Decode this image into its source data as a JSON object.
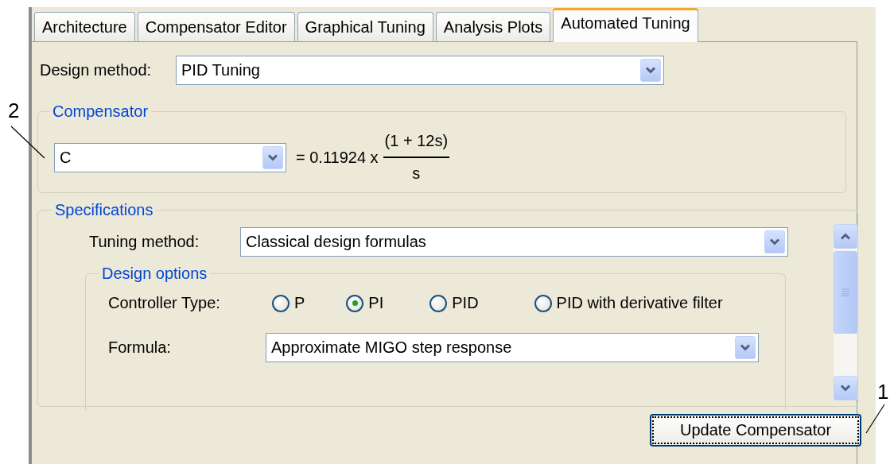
{
  "tabs": [
    {
      "label": "Architecture",
      "selected": false
    },
    {
      "label": "Compensator Editor",
      "selected": false
    },
    {
      "label": "Graphical Tuning",
      "selected": false
    },
    {
      "label": "Analysis Plots",
      "selected": false
    },
    {
      "label": "Automated Tuning",
      "selected": true
    }
  ],
  "design_method": {
    "label": "Design method:",
    "value": "PID Tuning"
  },
  "compensator": {
    "title": "Compensator",
    "selector": "C",
    "equation": {
      "prefix": "= 0.11924 x",
      "numerator": "(1 + 12s)",
      "denominator": "s"
    }
  },
  "specifications": {
    "title": "Specifications",
    "tuning_method": {
      "label": "Tuning method:",
      "value": "Classical design formulas"
    },
    "design_options": {
      "title": "Design options",
      "controller_type": {
        "label": "Controller Type:",
        "options": [
          {
            "label": "P",
            "selected": false
          },
          {
            "label": "PI",
            "selected": true
          },
          {
            "label": "PID",
            "selected": false
          },
          {
            "label": "PID with derivative filter",
            "selected": false
          }
        ]
      },
      "formula": {
        "label": "Formula:",
        "value": "Approximate MIGO step response"
      }
    }
  },
  "buttons": [
    {
      "label": "Update Compensator",
      "focused": true
    }
  ],
  "callouts": [
    {
      "label": "2"
    },
    {
      "label": "1"
    }
  ]
}
